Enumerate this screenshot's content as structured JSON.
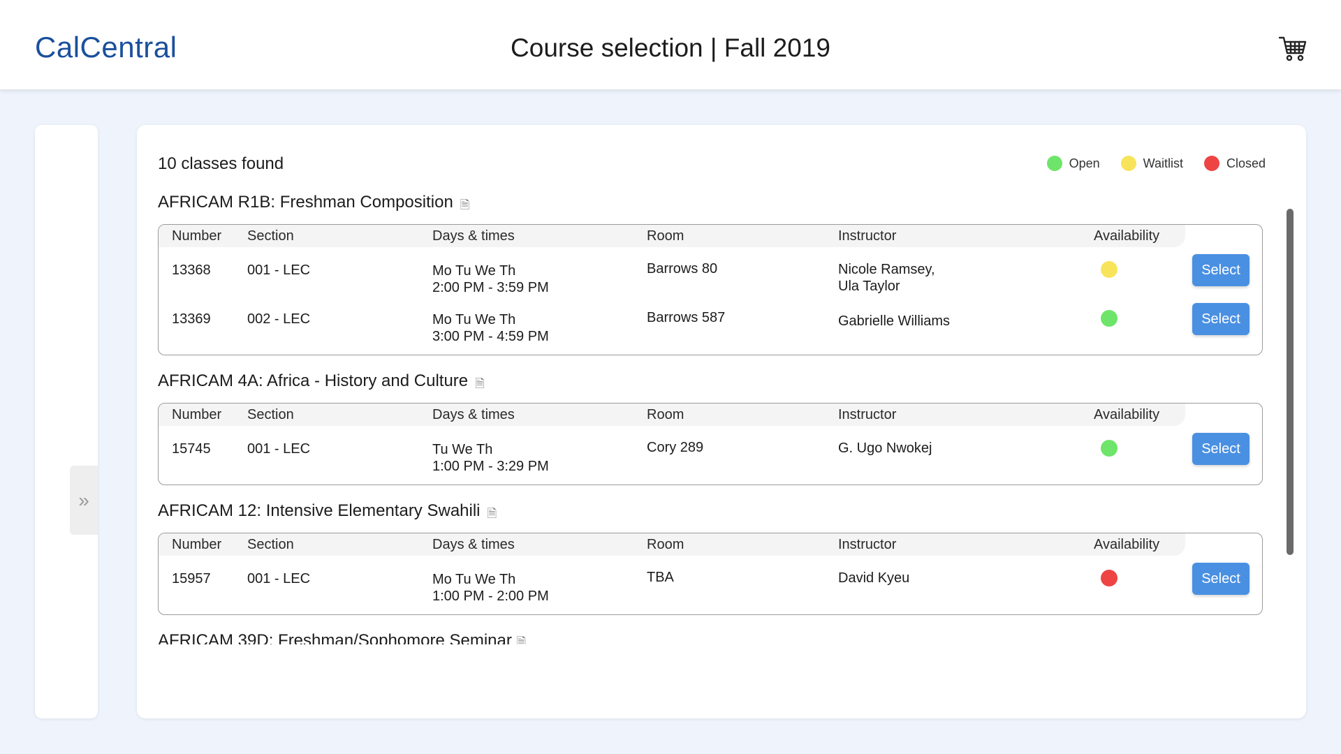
{
  "header": {
    "brand": "CalCentral",
    "title": "Course selection | Fall 2019",
    "cart_icon": "shopping-cart-icon"
  },
  "sidebar": {
    "expand_label": "»"
  },
  "results": {
    "count_label": "10 classes found"
  },
  "legend": [
    {
      "label": "Open",
      "color": "#6fe46a"
    },
    {
      "label": "Waitlist",
      "color": "#f8e45a"
    },
    {
      "label": "Closed",
      "color": "#ee4444"
    }
  ],
  "table_headers": {
    "number": "Number",
    "section": "Section",
    "days": "Days & times",
    "room": "Room",
    "instructor": "Instructor",
    "availability": "Availability"
  },
  "courses": [
    {
      "title": "AFRICAM R1B: Freshman Composition",
      "sections": [
        {
          "number": "13368",
          "section": "001 - LEC",
          "days": "Mo Tu We Th",
          "times": "2:00 PM - 3:59 PM",
          "room": "Barrows 80",
          "instructor_line1": "Nicole Ramsey,",
          "instructor_line2": "Ula Taylor",
          "availability": "waitlist",
          "button": "Select"
        },
        {
          "number": "13369",
          "section": "002 - LEC",
          "days": "Mo Tu We Th",
          "times": "3:00 PM - 4:59 PM",
          "room": "Barrows 587",
          "instructor_line1": "",
          "instructor_line2": "Gabrielle Williams",
          "availability": "open",
          "button": "Select"
        }
      ]
    },
    {
      "title": "AFRICAM 4A: Africa - History and Culture",
      "sections": [
        {
          "number": "15745",
          "section": "001 - LEC",
          "days": "Tu We Th",
          "times": "1:00 PM - 3:29 PM",
          "room": "Cory 289",
          "instructor_line1": "G. Ugo Nwokej",
          "instructor_line2": "",
          "availability": "open",
          "button": "Select"
        }
      ]
    },
    {
      "title": "AFRICAM 12: Intensive Elementary Swahili",
      "sections": [
        {
          "number": "15957",
          "section": "001 - LEC",
          "days": "Mo Tu We Th",
          "times": "1:00 PM - 2:00 PM",
          "room": "TBA",
          "instructor_line1": "David Kyeu",
          "instructor_line2": "",
          "availability": "closed",
          "button": "Select"
        }
      ]
    }
  ],
  "partial_course_title": "AFRICAM 39D: Freshman/Sophomore Seminar",
  "doc_icon": "document-icon"
}
